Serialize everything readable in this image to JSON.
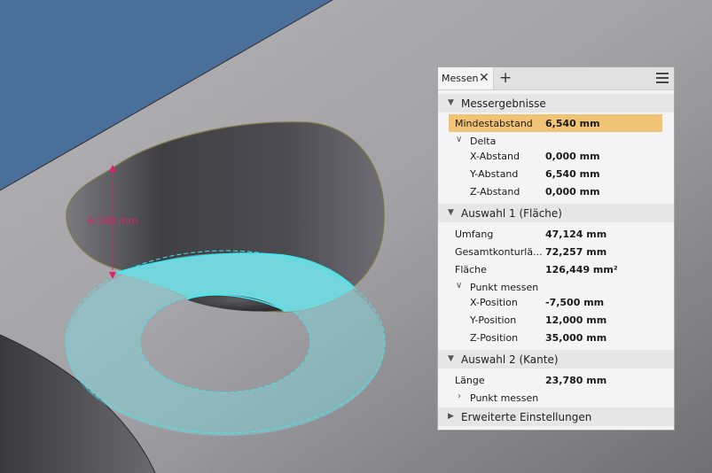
{
  "viewport": {
    "dimension_label": "6,540 mm",
    "colors": {
      "background_blue": "#4a6f9a",
      "surface_gray": "#9a9aa0",
      "highlight_cyan": "#66d9e0",
      "dimension_magenta": "#e0206a"
    }
  },
  "panel": {
    "tab_label": "Messen",
    "close_icon": "✕",
    "add_icon": "+",
    "sections": {
      "results": {
        "title": "Messergebnisse",
        "min_distance_label": "Mindestabstand",
        "min_distance_value": "6,540 mm",
        "delta_label": "Delta",
        "x_label": "X-Abstand",
        "x_value": "0,000 mm",
        "y_label": "Y-Abstand",
        "y_value": "6,540 mm",
        "z_label": "Z-Abstand",
        "z_value": "0,000 mm"
      },
      "selection1": {
        "title": "Auswahl 1 (Fläche)",
        "perimeter_label": "Umfang",
        "perimeter_value": "47,124 mm",
        "total_contour_label": "Gesamtkonturlä...",
        "total_contour_value": "72,257 mm",
        "area_label": "Fläche",
        "area_value": "126,449 mm²",
        "point_label": "Punkt messen",
        "x_pos_label": "X-Position",
        "x_pos_value": "-7,500 mm",
        "y_pos_label": "Y-Position",
        "y_pos_value": "12,000 mm",
        "z_pos_label": "Z-Position",
        "z_pos_value": "35,000 mm"
      },
      "selection2": {
        "title": "Auswahl 2 (Kante)",
        "length_label": "Länge",
        "length_value": "23,780 mm",
        "point_label": "Punkt messen"
      },
      "advanced": {
        "title": "Erweiterte Einstellungen"
      }
    }
  }
}
